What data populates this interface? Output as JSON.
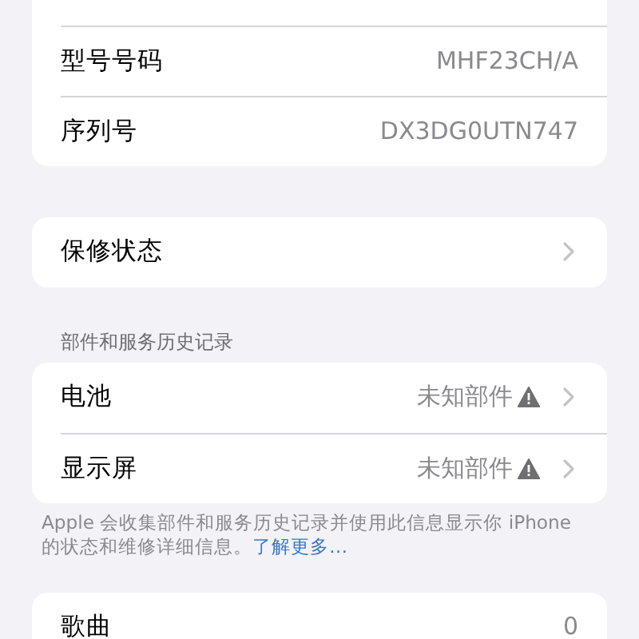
{
  "groups": [
    {
      "rows": [
        {
          "label": "型号号码",
          "value": "MHF23CH/A",
          "warning": false,
          "chevron": false
        },
        {
          "label": "序列号",
          "value": "DX3DG0UTN747",
          "warning": false,
          "chevron": false
        }
      ]
    },
    {
      "rows": [
        {
          "label": "保修状态",
          "warning": false,
          "chevron": true
        }
      ]
    },
    {
      "header": "部件和服务历史记录",
      "rows": [
        {
          "label": "电池",
          "value": "未知部件",
          "warning": true,
          "chevron": true
        },
        {
          "label": "显示屏",
          "value": "未知部件",
          "warning": true,
          "chevron": true
        }
      ],
      "footer": {
        "text": "Apple 会收集部件和服务历史记录并使用此信息显示你 iPhone 的状态和维修详细信息。",
        "link": "了解更多…"
      }
    },
    {
      "rows": [
        {
          "label": "歌曲",
          "value": "0",
          "warning": false,
          "chevron": false
        }
      ]
    }
  ]
}
